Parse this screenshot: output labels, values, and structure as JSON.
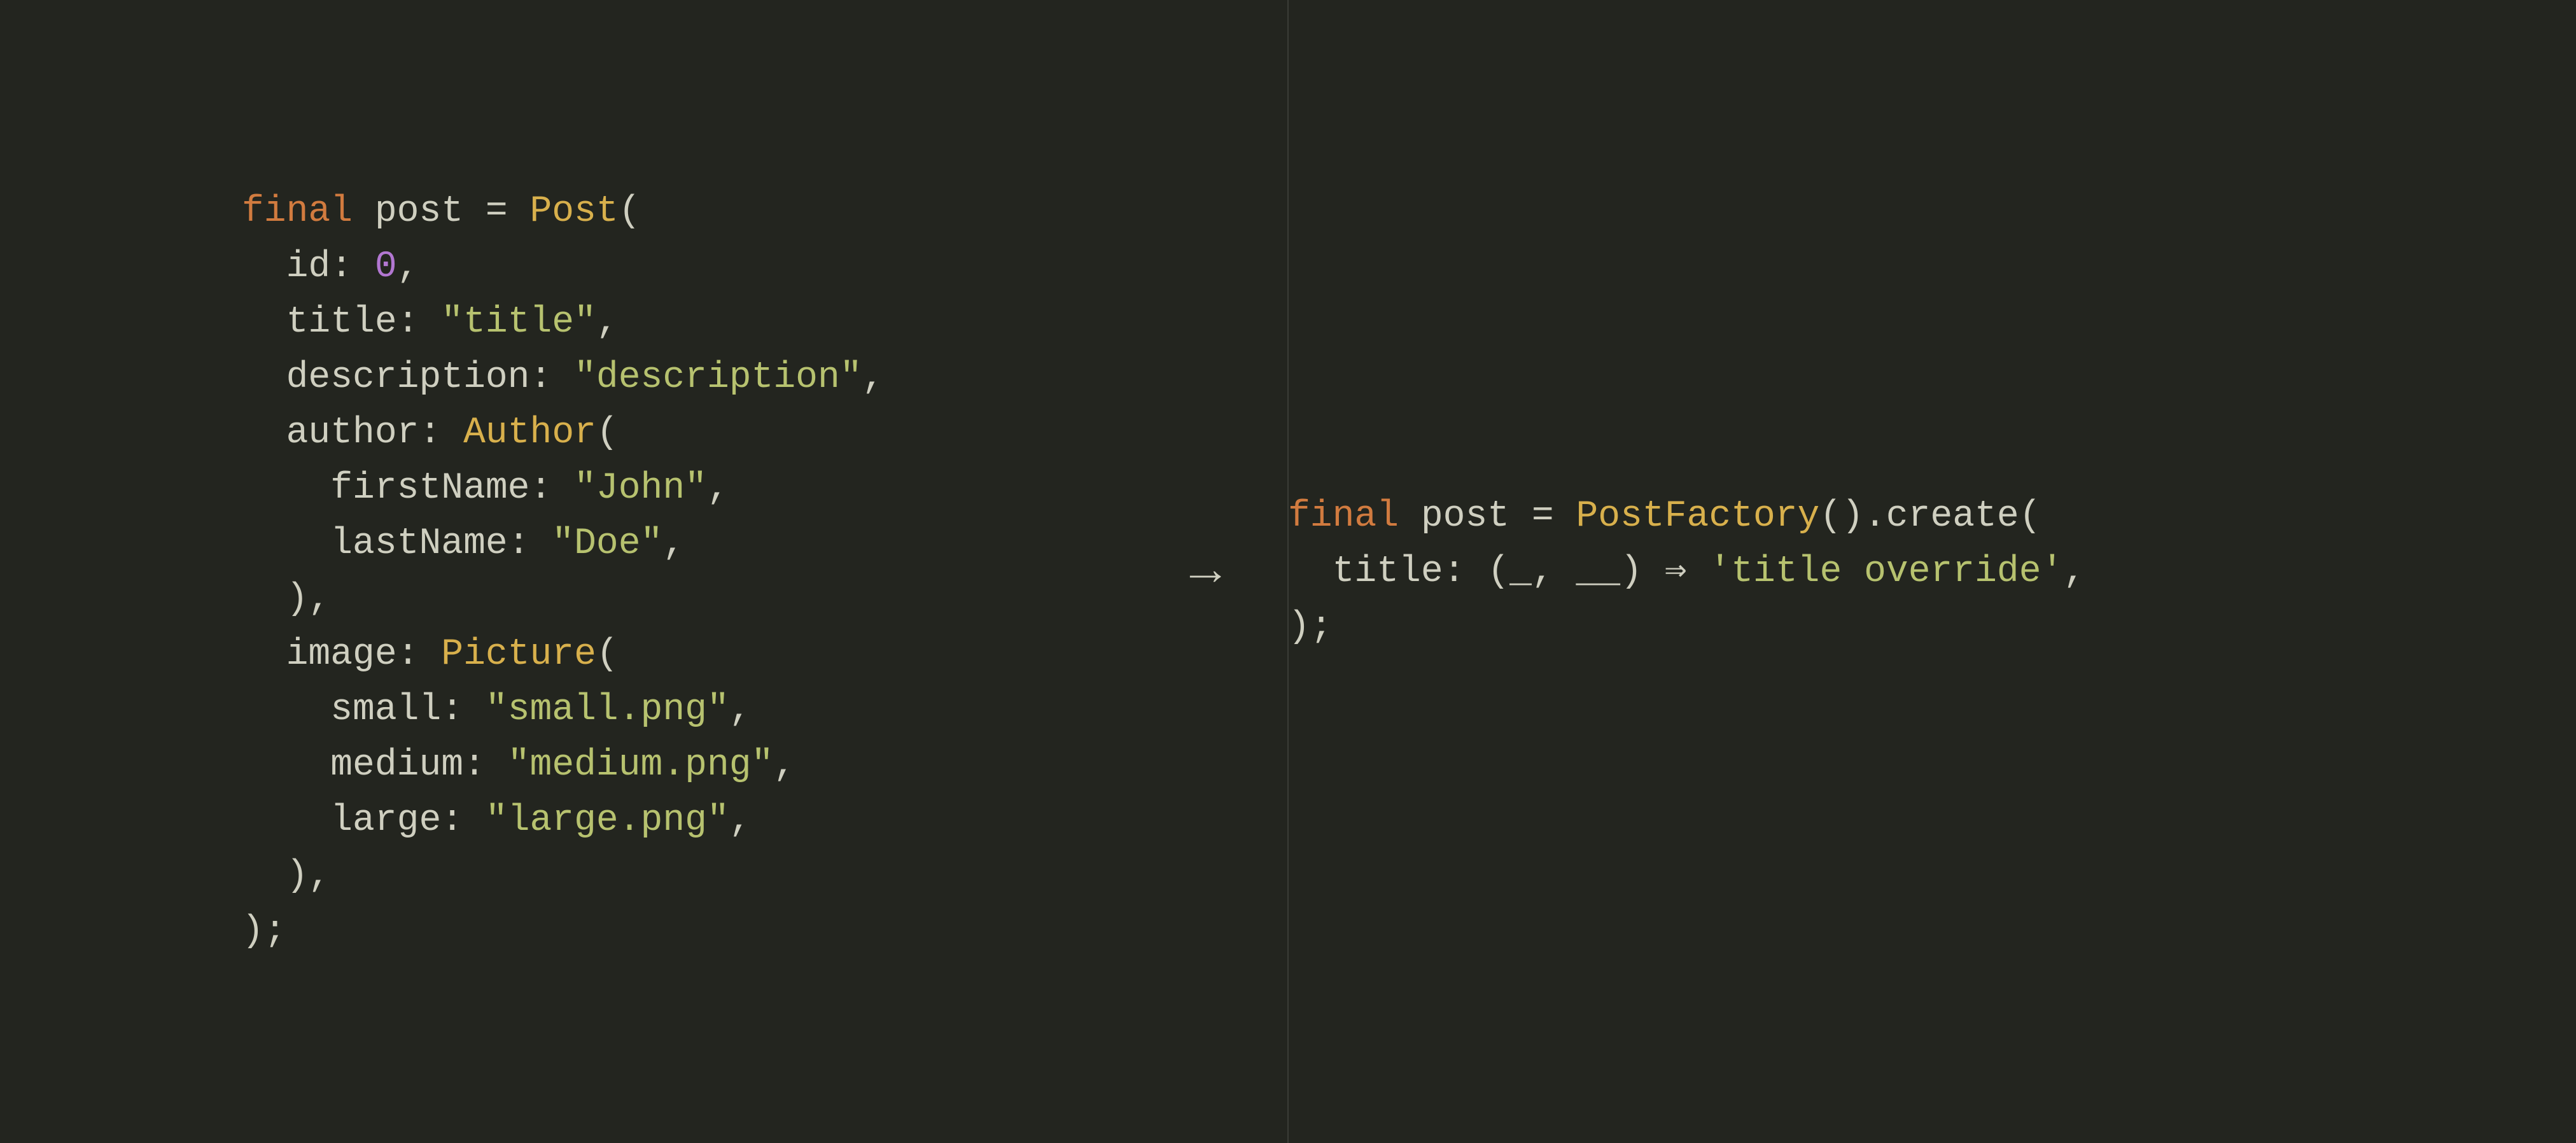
{
  "colors": {
    "background": "#23251f",
    "divider": "#3b3c36",
    "text": "#cfcfc0",
    "keyword": "#d17b3f",
    "type": "#d8b04c",
    "number": "#b277d1",
    "string": "#b7c26f"
  },
  "arrow_glyph": "→",
  "left_code": {
    "language": "dart",
    "tokens": [
      [
        {
          "t": "kw",
          "v": "final"
        },
        {
          "t": "pu",
          "v": " "
        },
        {
          "t": "id",
          "v": "post"
        },
        {
          "t": "pu",
          "v": " = "
        },
        {
          "t": "ty",
          "v": "Post"
        },
        {
          "t": "pu",
          "v": "("
        }
      ],
      [
        {
          "t": "pu",
          "v": "  "
        },
        {
          "t": "id",
          "v": "id"
        },
        {
          "t": "pu",
          "v": ": "
        },
        {
          "t": "num",
          "v": "0"
        },
        {
          "t": "pu",
          "v": ","
        }
      ],
      [
        {
          "t": "pu",
          "v": "  "
        },
        {
          "t": "id",
          "v": "title"
        },
        {
          "t": "pu",
          "v": ": "
        },
        {
          "t": "str",
          "v": "\"title\""
        },
        {
          "t": "pu",
          "v": ","
        }
      ],
      [
        {
          "t": "pu",
          "v": "  "
        },
        {
          "t": "id",
          "v": "description"
        },
        {
          "t": "pu",
          "v": ": "
        },
        {
          "t": "str",
          "v": "\"description\""
        },
        {
          "t": "pu",
          "v": ","
        }
      ],
      [
        {
          "t": "pu",
          "v": "  "
        },
        {
          "t": "id",
          "v": "author"
        },
        {
          "t": "pu",
          "v": ": "
        },
        {
          "t": "ty",
          "v": "Author"
        },
        {
          "t": "pu",
          "v": "("
        }
      ],
      [
        {
          "t": "pu",
          "v": "    "
        },
        {
          "t": "id",
          "v": "firstName"
        },
        {
          "t": "pu",
          "v": ": "
        },
        {
          "t": "str",
          "v": "\"John\""
        },
        {
          "t": "pu",
          "v": ","
        }
      ],
      [
        {
          "t": "pu",
          "v": "    "
        },
        {
          "t": "id",
          "v": "lastName"
        },
        {
          "t": "pu",
          "v": ": "
        },
        {
          "t": "str",
          "v": "\"Doe\""
        },
        {
          "t": "pu",
          "v": ","
        }
      ],
      [
        {
          "t": "pu",
          "v": "  ),"
        }
      ],
      [
        {
          "t": "pu",
          "v": "  "
        },
        {
          "t": "id",
          "v": "image"
        },
        {
          "t": "pu",
          "v": ": "
        },
        {
          "t": "ty",
          "v": "Picture"
        },
        {
          "t": "pu",
          "v": "("
        }
      ],
      [
        {
          "t": "pu",
          "v": "    "
        },
        {
          "t": "id",
          "v": "small"
        },
        {
          "t": "pu",
          "v": ": "
        },
        {
          "t": "str",
          "v": "\"small.png\""
        },
        {
          "t": "pu",
          "v": ","
        }
      ],
      [
        {
          "t": "pu",
          "v": "    "
        },
        {
          "t": "id",
          "v": "medium"
        },
        {
          "t": "pu",
          "v": ": "
        },
        {
          "t": "str",
          "v": "\"medium.png\""
        },
        {
          "t": "pu",
          "v": ","
        }
      ],
      [
        {
          "t": "pu",
          "v": "    "
        },
        {
          "t": "id",
          "v": "large"
        },
        {
          "t": "pu",
          "v": ": "
        },
        {
          "t": "str",
          "v": "\"large.png\""
        },
        {
          "t": "pu",
          "v": ","
        }
      ],
      [
        {
          "t": "pu",
          "v": "  ),"
        }
      ],
      [
        {
          "t": "pu",
          "v": ");"
        }
      ]
    ]
  },
  "right_code": {
    "language": "dart",
    "tokens": [
      [
        {
          "t": "kw",
          "v": "final"
        },
        {
          "t": "pu",
          "v": " "
        },
        {
          "t": "id",
          "v": "post"
        },
        {
          "t": "pu",
          "v": " = "
        },
        {
          "t": "ty",
          "v": "PostFactory"
        },
        {
          "t": "pu",
          "v": "().create("
        }
      ],
      [
        {
          "t": "pu",
          "v": "  "
        },
        {
          "t": "id",
          "v": "title"
        },
        {
          "t": "pu",
          "v": ": (_, __) ⇒ "
        },
        {
          "t": "str",
          "v": "'title override'"
        },
        {
          "t": "pu",
          "v": ","
        }
      ],
      [
        {
          "t": "pu",
          "v": ");"
        }
      ]
    ]
  }
}
